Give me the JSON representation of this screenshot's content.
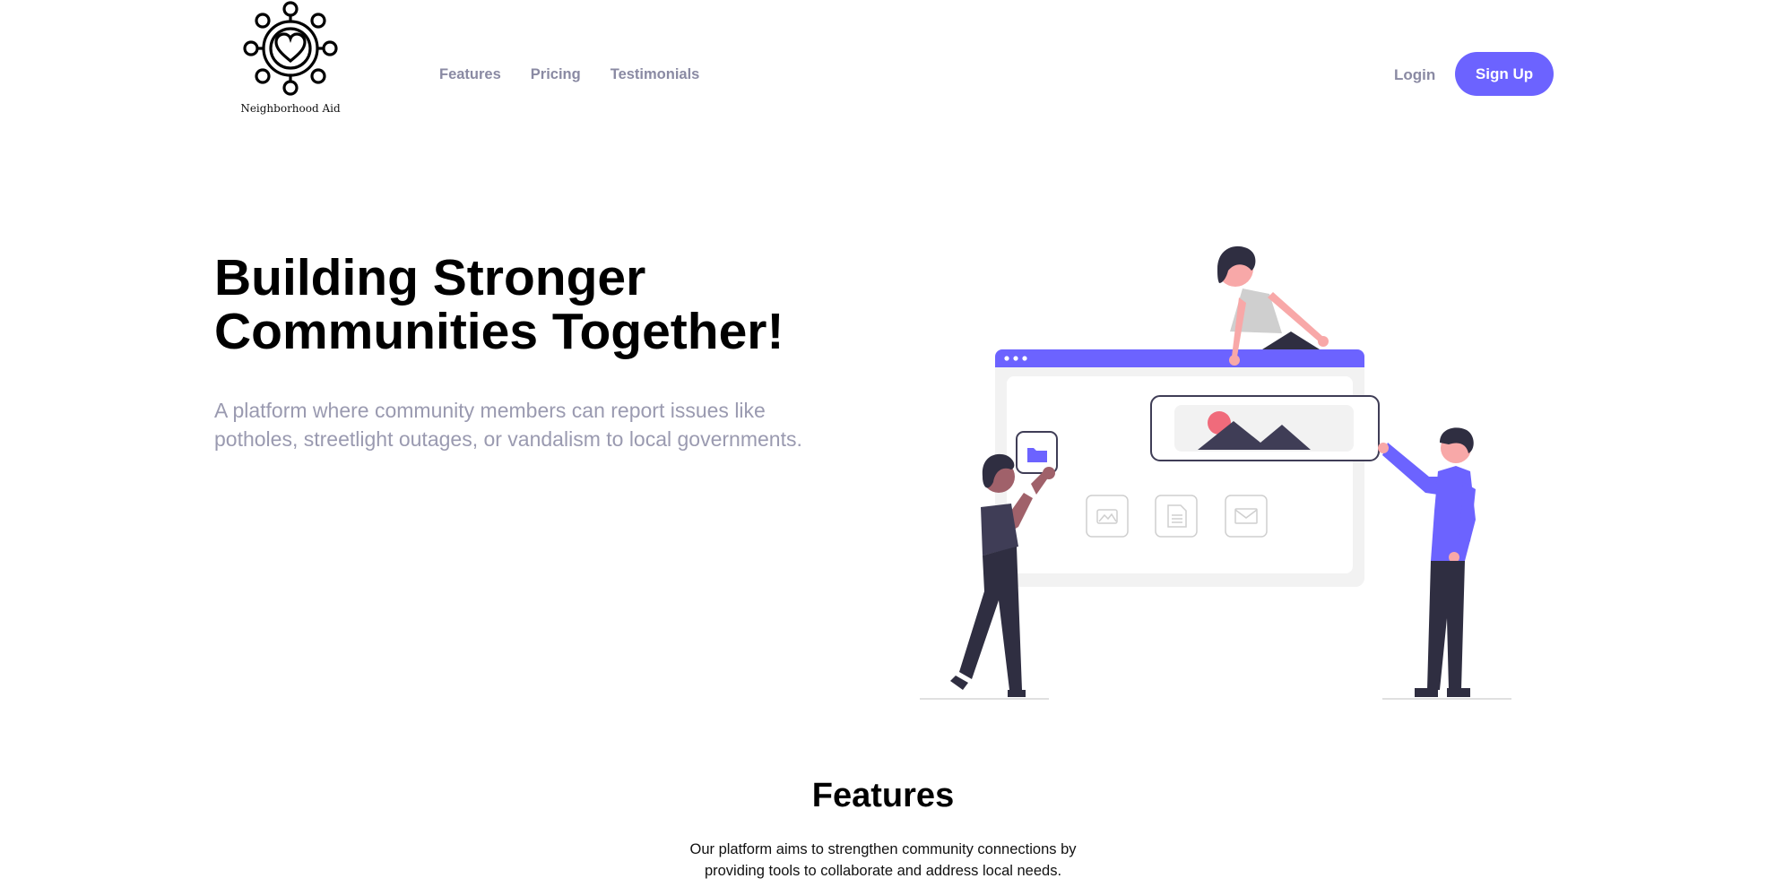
{
  "brand": {
    "name": "Neighborhood Aid"
  },
  "nav": {
    "items": [
      "Features",
      "Pricing",
      "Testimonials"
    ]
  },
  "auth": {
    "login_label": "Login",
    "signup_label": "Sign Up"
  },
  "hero": {
    "title_line1": "Building Stronger",
    "title_line2": "Communities Together!",
    "subtitle_line1": "A platform where community members can report issues like",
    "subtitle_line2": "potholes, streetlight outages, or vandalism to local governments."
  },
  "features": {
    "title": "Features",
    "desc_line1": "Our platform aims to strengthen community connections by",
    "desc_line2": "providing tools to collaborate and address local needs."
  },
  "colors": {
    "accent": "#6c63ff",
    "muted_text": "#9a9ab0",
    "nav_text": "#8a8aa3",
    "skin_pink": "#f8a8a8",
    "dark": "#2f2e41"
  },
  "icons": [
    "community-heart-logo-icon",
    "folder-icon",
    "image-icon",
    "document-icon",
    "mail-icon"
  ]
}
